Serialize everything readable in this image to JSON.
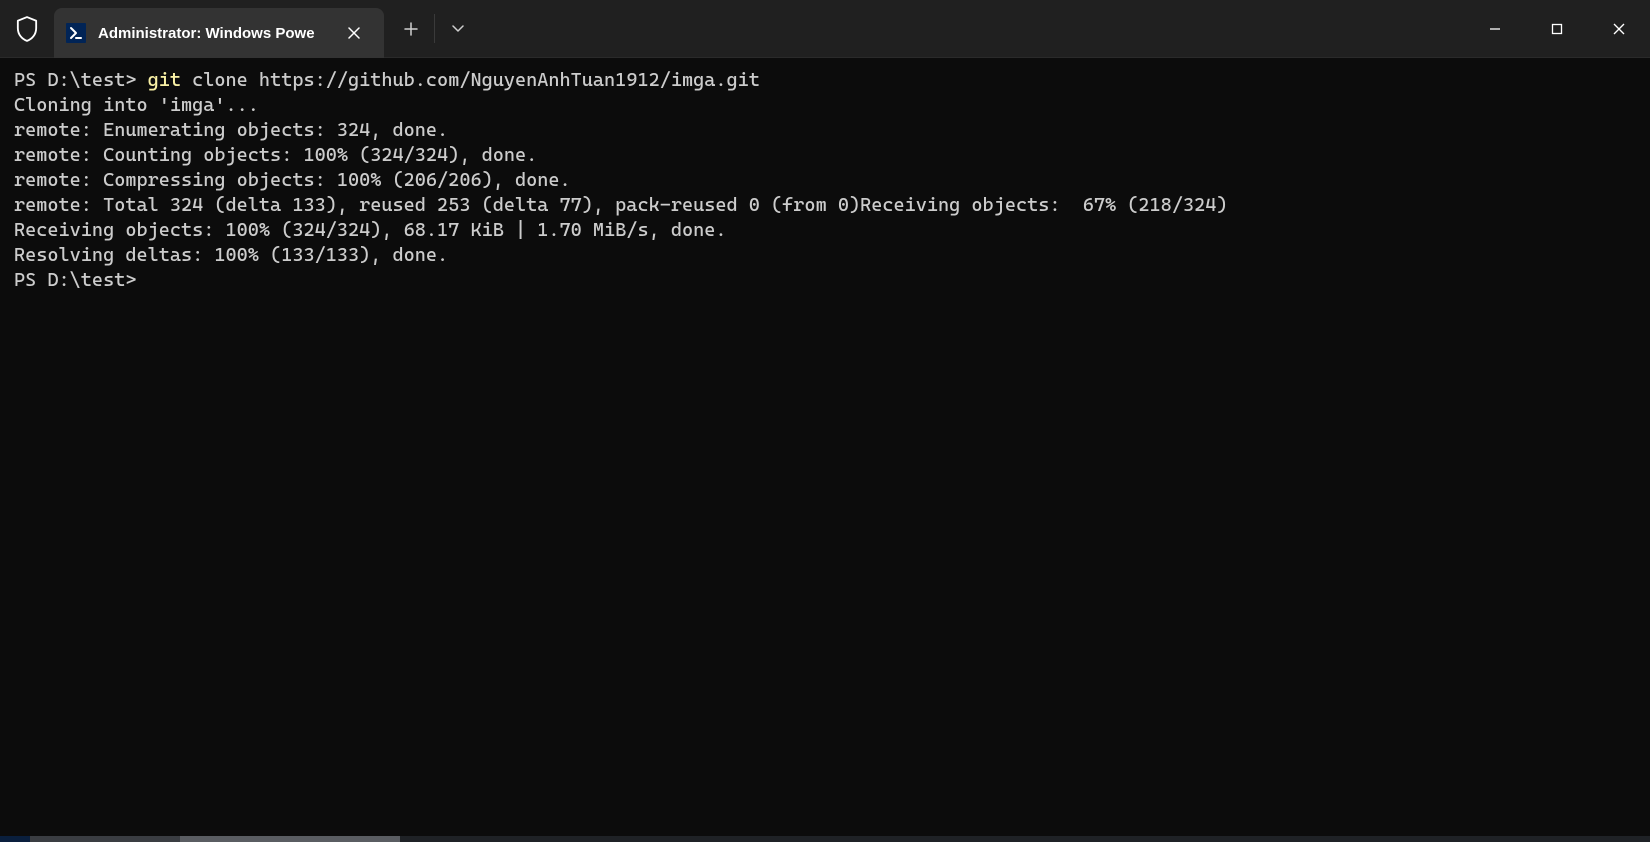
{
  "tab": {
    "title": "Administrator: Windows Powe"
  },
  "prompt1_prefix": "PS D:\\test> ",
  "prompt1_cmd_yellow": "git",
  "prompt1_cmd_rest": " clone https://github.com/NguyenAnhTuan1912/imga.git",
  "output_lines": [
    "Cloning into 'imga'...",
    "remote: Enumerating objects: 324, done.",
    "remote: Counting objects: 100% (324/324), done.",
    "remote: Compressing objects: 100% (206/206), done.",
    "remote: Total 324 (delta 133), reused 253 (delta 77), pack-reused 0 (from 0)Receiving objects:  67% (218/324)",
    "Receiving objects: 100% (324/324), 68.17 KiB | 1.70 MiB/s, done.",
    "Resolving deltas: 100% (133/133), done."
  ],
  "prompt2": "PS D:\\test>"
}
